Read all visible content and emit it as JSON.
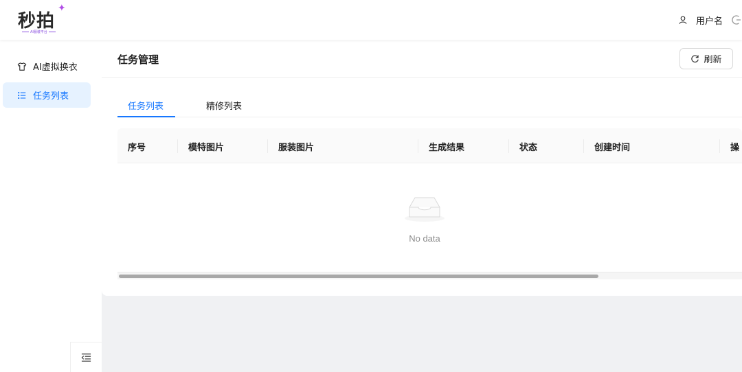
{
  "header": {
    "logo_text": "秒拍",
    "logo_subtitle": "AI服装平台",
    "user_name": "用户名"
  },
  "sidebar": {
    "items": [
      {
        "label": "AI虚拟换衣",
        "icon": "shirt-icon",
        "active": false
      },
      {
        "label": "任务列表",
        "icon": "list-icon",
        "active": true
      }
    ],
    "collapse_icon": "menu-fold-icon"
  },
  "main": {
    "title": "任务管理",
    "refresh_label": "刷新",
    "tabs": [
      {
        "label": "任务列表",
        "active": true
      },
      {
        "label": "精修列表",
        "active": false
      }
    ],
    "table": {
      "columns": [
        "序号",
        "模特图片",
        "服装图片",
        "生成结果",
        "状态",
        "创建时间",
        "操"
      ],
      "rows": [],
      "empty_text": "No data"
    }
  },
  "colors": {
    "accent": "#1677ff",
    "active_menu_bg": "#e6f2ff",
    "logo_star": "#b14ee6"
  }
}
